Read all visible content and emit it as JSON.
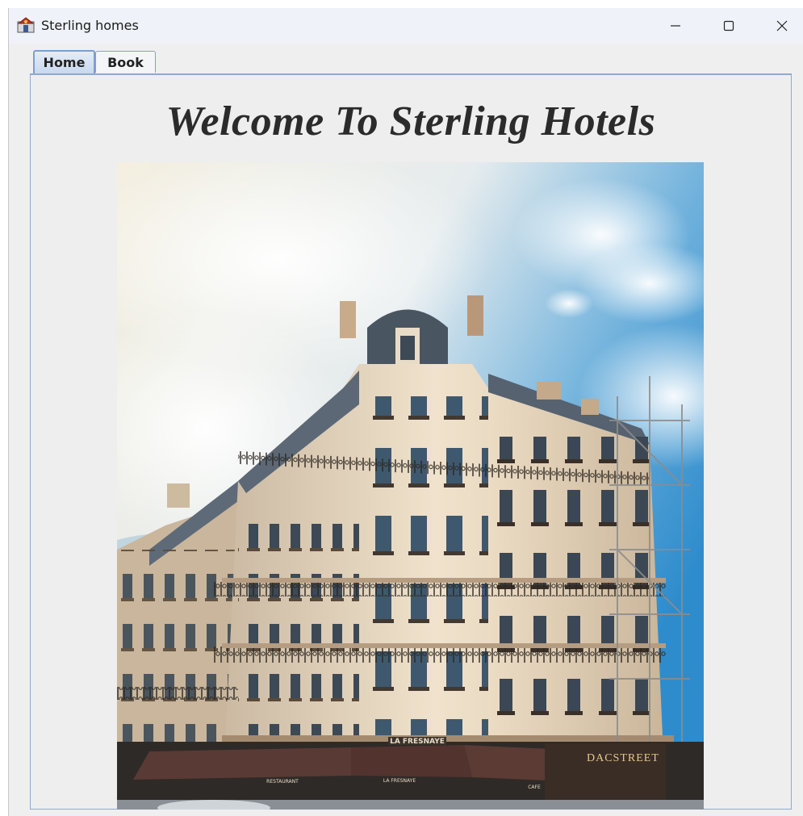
{
  "window": {
    "title": "Sterling homes",
    "icon": "java-app-icon",
    "controls": {
      "minimize": "minimize-icon",
      "maximize": "maximize-icon",
      "close": "close-icon"
    }
  },
  "tabs": [
    {
      "label": "Home",
      "selected": true
    },
    {
      "label": "Book",
      "selected": false
    }
  ],
  "home": {
    "heading": "Welcome To Sterling Hotels",
    "photo": {
      "subject": "hotel-building-photo",
      "signs": {
        "corner": "LA FRESNAYE",
        "right": "DACSTREET",
        "awning_left": "RESTAURANT",
        "awning_mid": "LA FRESNAYE",
        "awning_right": "CAFE"
      }
    }
  },
  "colors": {
    "title_bar": "#eff3f9",
    "window_bg": "#efeff0",
    "tab_selected": "#c9d9ef",
    "panel_border": "#8fa9d0",
    "sky": "#3f96cf"
  }
}
